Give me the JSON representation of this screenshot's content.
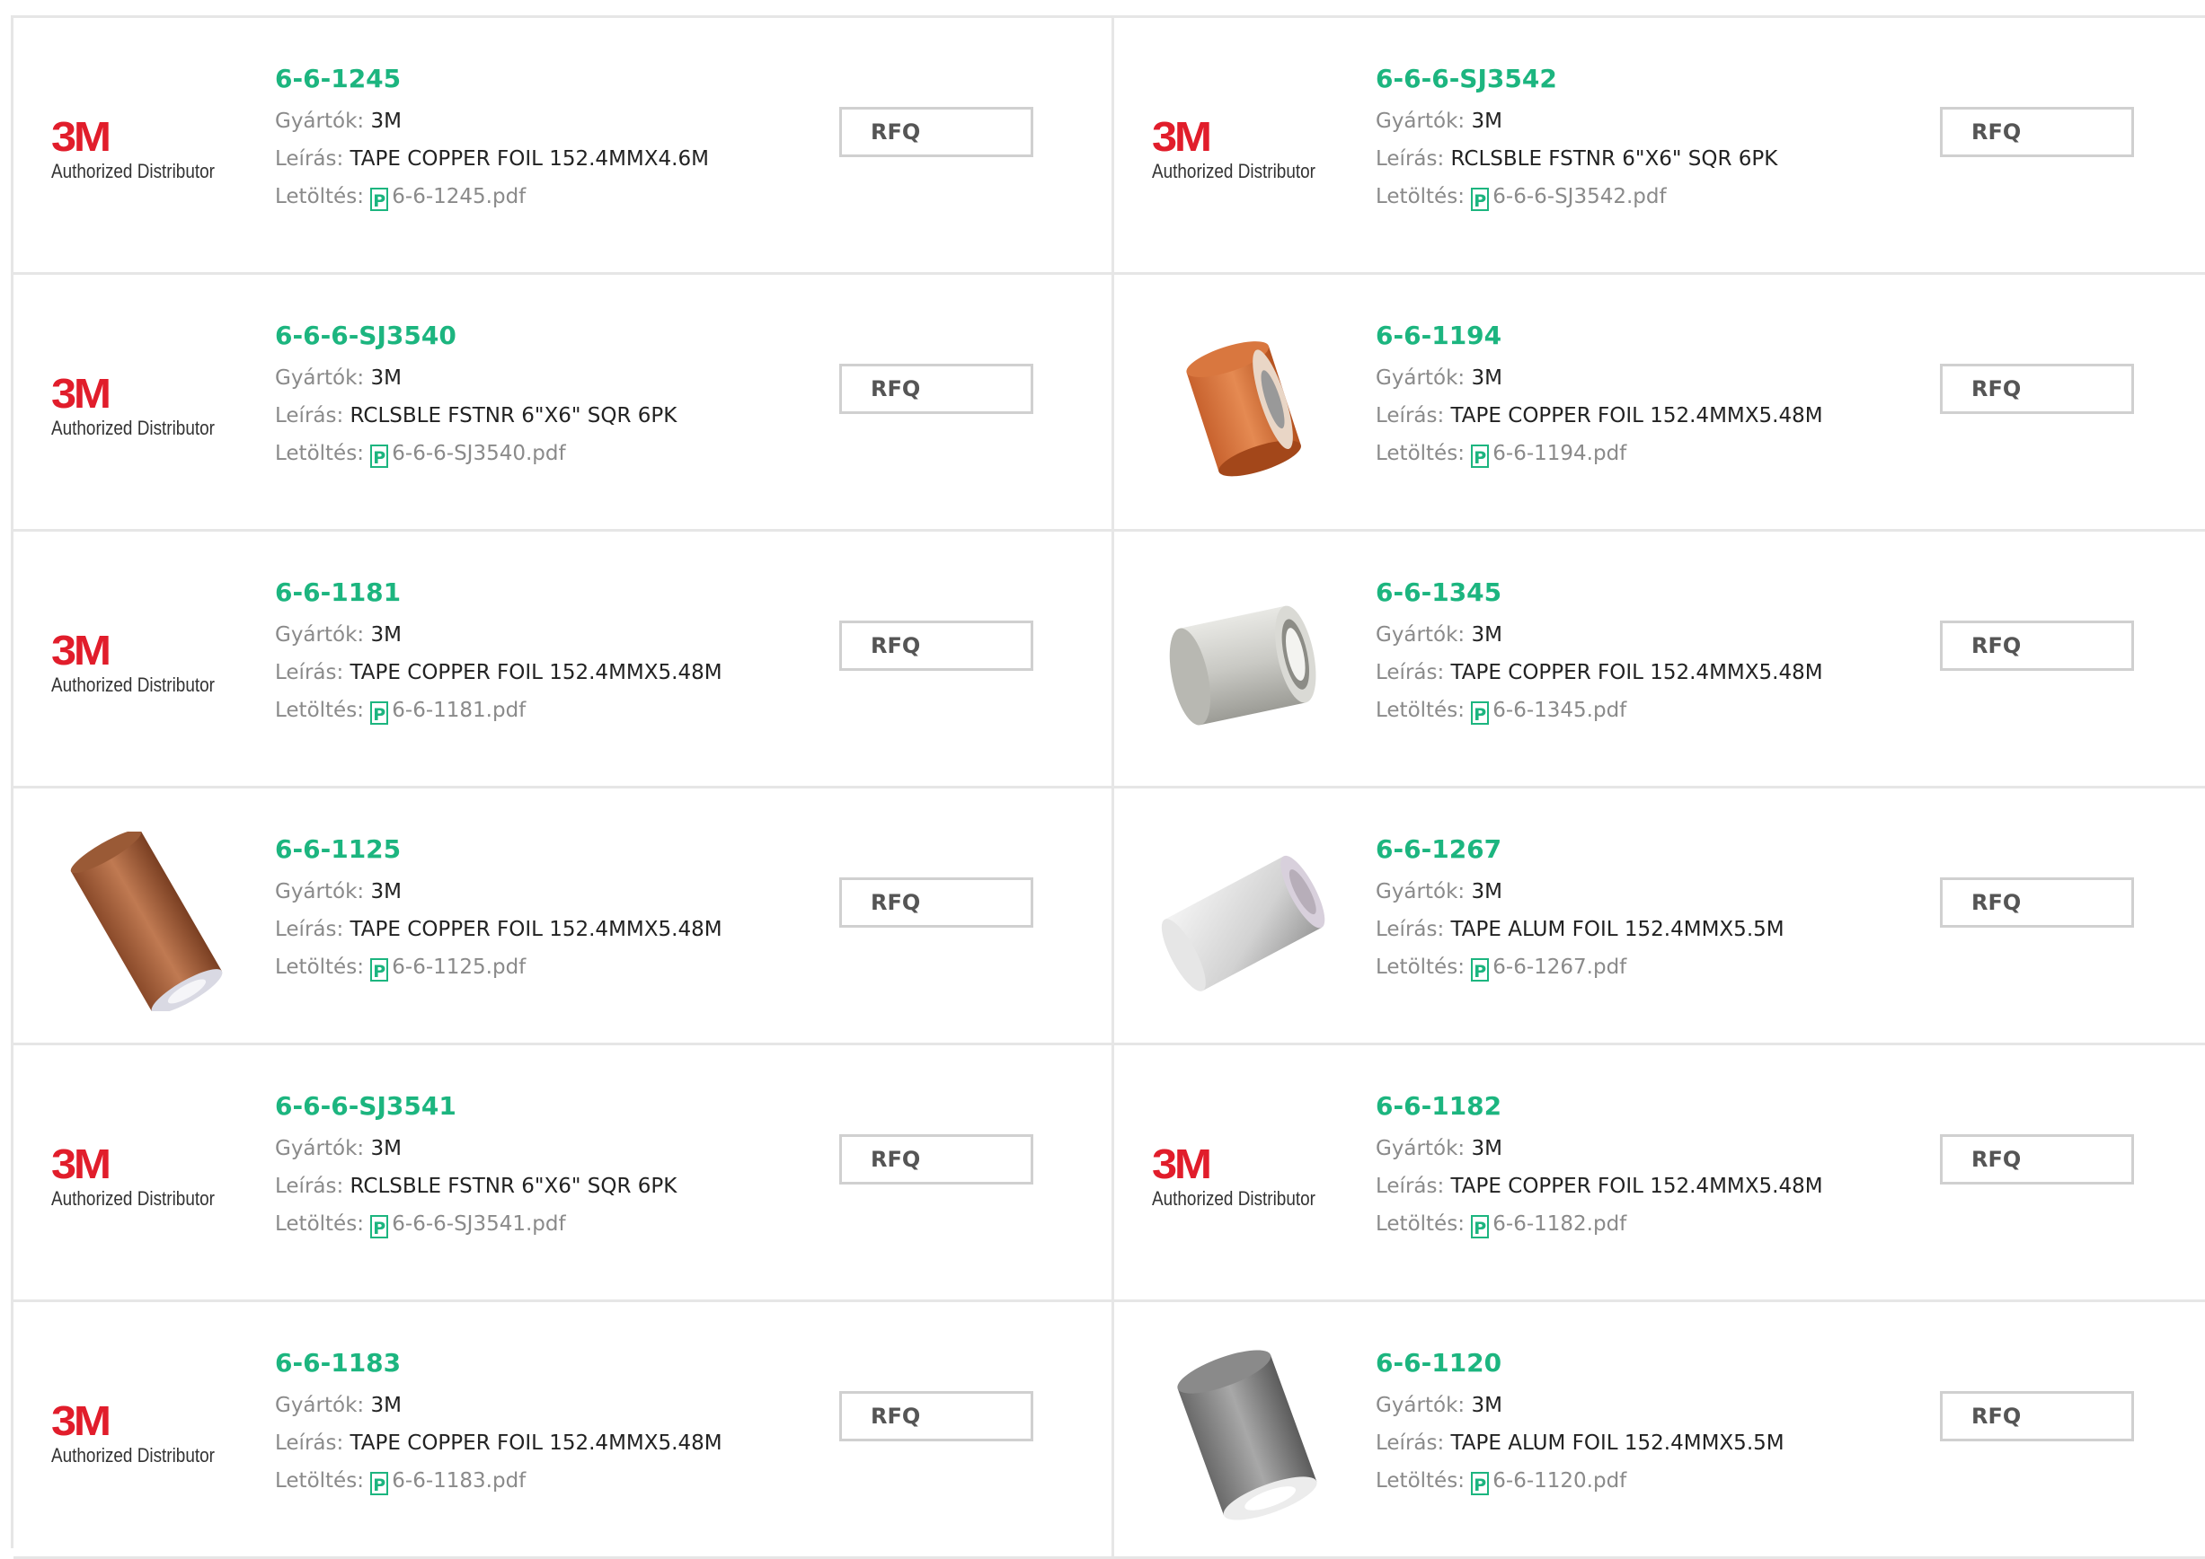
{
  "labels": {
    "manufacturer": "Gyártók:",
    "description": "Leírás:",
    "download": "Letöltés:",
    "rfq": "RFQ",
    "pdf_glyph": "P"
  },
  "logo": {
    "brand": "3M",
    "tagline": "Authorized Distributor"
  },
  "colors": {
    "accent": "#1cb57f",
    "brand_red": "#e11d2b"
  },
  "products": [
    {
      "part": "6-6-1245",
      "manufacturer": "3M",
      "description": "TAPE COPPER FOIL 152.4MMX4.6M",
      "pdf": "6-6-1245.pdf",
      "image": "3m-logo"
    },
    {
      "part": "6-6-6-SJ3542",
      "manufacturer": "3M",
      "description": "RCLSBLE FSTNR 6\"X6\" SQR 6PK",
      "pdf": "6-6-6-SJ3542.pdf",
      "image": "3m-logo"
    },
    {
      "part": "6-6-6-SJ3540",
      "manufacturer": "3M",
      "description": "RCLSBLE FSTNR 6\"X6\" SQR 6PK",
      "pdf": "6-6-6-SJ3540.pdf",
      "image": "3m-logo"
    },
    {
      "part": "6-6-1194",
      "manufacturer": "3M",
      "description": "TAPE COPPER FOIL 152.4MMX5.48M",
      "pdf": "6-6-1194.pdf",
      "image": "copper-roll-short"
    },
    {
      "part": "6-6-1181",
      "manufacturer": "3M",
      "description": "TAPE COPPER FOIL 152.4MMX5.48M",
      "pdf": "6-6-1181.pdf",
      "image": "3m-logo"
    },
    {
      "part": "6-6-1345",
      "manufacturer": "3M",
      "description": "TAPE COPPER FOIL 152.4MMX5.48M",
      "pdf": "6-6-1345.pdf",
      "image": "grey-roll"
    },
    {
      "part": "6-6-1125",
      "manufacturer": "3M",
      "description": "TAPE COPPER FOIL 152.4MMX5.48M",
      "pdf": "6-6-1125.pdf",
      "image": "copper-roll-long"
    },
    {
      "part": "6-6-1267",
      "manufacturer": "3M",
      "description": "TAPE ALUM FOIL 152.4MMX5.5M",
      "pdf": "6-6-1267.pdf",
      "image": "silver-roll"
    },
    {
      "part": "6-6-6-SJ3541",
      "manufacturer": "3M",
      "description": "RCLSBLE FSTNR 6\"X6\" SQR 6PK",
      "pdf": "6-6-6-SJ3541.pdf",
      "image": "3m-logo"
    },
    {
      "part": "6-6-1182",
      "manufacturer": "3M",
      "description": "TAPE COPPER FOIL 152.4MMX5.48M",
      "pdf": "6-6-1182.pdf",
      "image": "3m-logo"
    },
    {
      "part": "6-6-1183",
      "manufacturer": "3M",
      "description": "TAPE COPPER FOIL 152.4MMX5.48M",
      "pdf": "6-6-1183.pdf",
      "image": "3m-logo"
    },
    {
      "part": "6-6-1120",
      "manufacturer": "3M",
      "description": "TAPE ALUM FOIL 152.4MMX5.5M",
      "pdf": "6-6-1120.pdf",
      "image": "dark-alum-roll"
    }
  ]
}
